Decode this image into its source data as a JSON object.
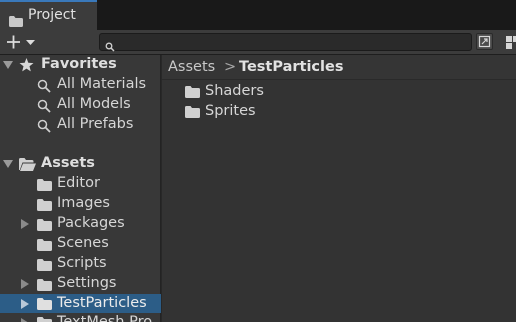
{
  "tab": {
    "label": "Project"
  },
  "toolbar": {
    "search_value": ""
  },
  "favorites": {
    "label": "Favorites",
    "items": [
      {
        "label": "All Materials"
      },
      {
        "label": "All Models"
      },
      {
        "label": "All Prefabs"
      }
    ]
  },
  "assets": {
    "label": "Assets",
    "items": [
      {
        "label": "Editor"
      },
      {
        "label": "Images"
      },
      {
        "label": "Packages"
      },
      {
        "label": "Scenes"
      },
      {
        "label": "Scripts"
      },
      {
        "label": "Settings"
      },
      {
        "label": "TestParticles"
      },
      {
        "label": "TextMesh Pro"
      }
    ]
  },
  "breadcrumb": {
    "root": "Assets",
    "separator": ">",
    "current": "TestParticles"
  },
  "contents": [
    {
      "label": "Shaders"
    },
    {
      "label": "Sprites"
    }
  ],
  "colors": {
    "accent": "#3a79bb",
    "selection": "#2c5d87"
  }
}
